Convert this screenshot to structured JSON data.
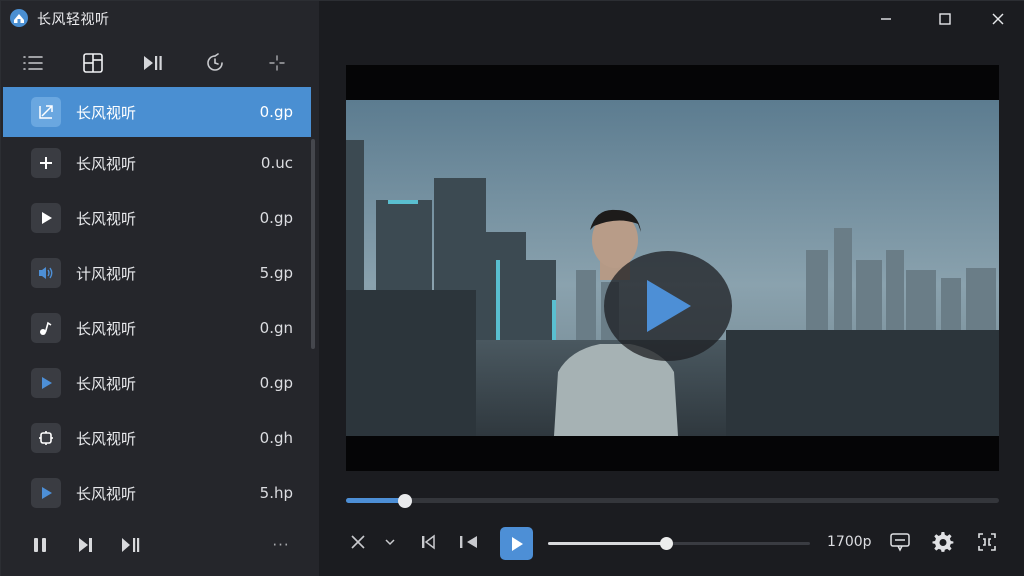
{
  "app": {
    "title": "长风轻视听",
    "accent": "#4d8fd6"
  },
  "tabs": [
    {
      "icon": "playlist-icon"
    },
    {
      "icon": "layout-icon",
      "active": true
    },
    {
      "icon": "play-pause-icon"
    },
    {
      "icon": "timer-icon"
    },
    {
      "icon": "crosshair-icon"
    }
  ],
  "playlist": [
    {
      "name": "长风视听",
      "ext": "0.gp",
      "icon": "share-icon",
      "selected": true
    },
    {
      "name": "长风视听",
      "ext": "0.uc",
      "icon": "plus-icon"
    },
    {
      "name": "长风视听",
      "ext": "0.gp",
      "icon": "play-icon"
    },
    {
      "name": "计风视听",
      "ext": "5.gp",
      "icon": "speaker-icon"
    },
    {
      "name": "长风视听",
      "ext": "0.gn",
      "icon": "music-note-icon"
    },
    {
      "name": "长风视听",
      "ext": "0.gp",
      "icon": "play-icon"
    },
    {
      "name": "长风视听",
      "ext": "0.gh",
      "icon": "frame-icon"
    },
    {
      "name": "长风视听",
      "ext": "5.hp",
      "icon": "play-icon"
    }
  ],
  "left_controls": {
    "more_label": "···"
  },
  "player": {
    "progress": 0.09,
    "volume": 0.45,
    "quality": "1700p"
  }
}
